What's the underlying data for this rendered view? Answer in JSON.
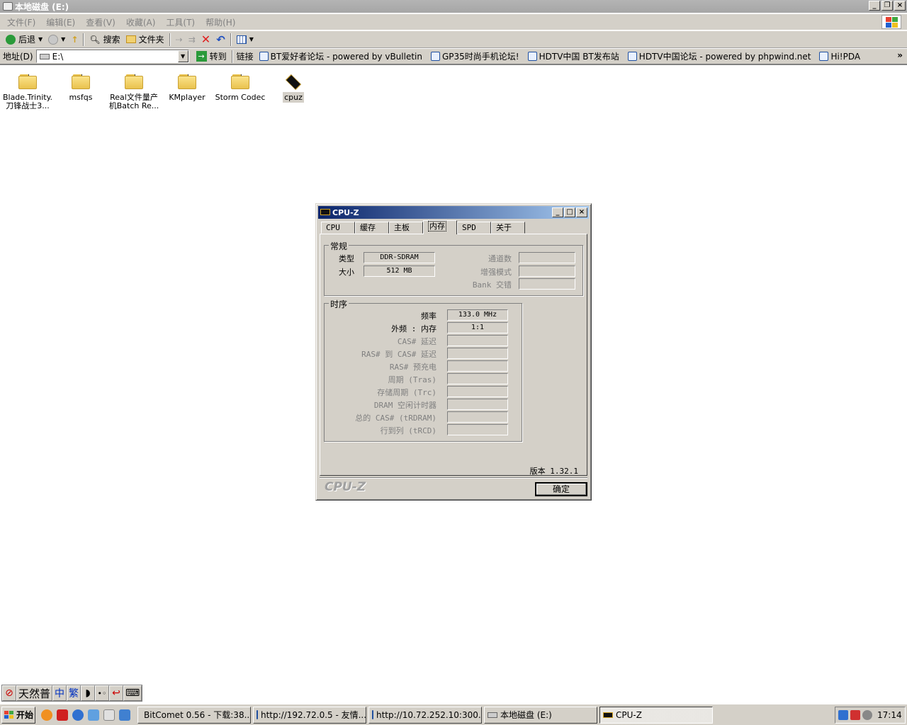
{
  "window": {
    "title": "本地磁盘 (E:)"
  },
  "menubar": [
    "文件(F)",
    "编辑(E)",
    "查看(V)",
    "收藏(A)",
    "工具(T)",
    "帮助(H)"
  ],
  "toolbar": {
    "back": "后退",
    "search": "搜索",
    "folders": "文件夹"
  },
  "address": {
    "label": "地址(D)",
    "value": "E:\\",
    "go": "转到",
    "links_label": "链接"
  },
  "links": [
    "BT爱好者论坛 - powered by vBulletin",
    "GP35时尚手机论坛!",
    "HDTV中国 BT发布站",
    "HDTV中国论坛 - powered by phpwind.net",
    "Hi!PDA"
  ],
  "files": [
    {
      "name": "Blade.Trinity.刀锋战士3...",
      "icon": "folder-icon"
    },
    {
      "name": "msfqs",
      "icon": "folder-icon"
    },
    {
      "name": "Real文件量产机Batch Re...",
      "icon": "folder-icon"
    },
    {
      "name": "KMplayer",
      "icon": "folder-icon"
    },
    {
      "name": "Storm Codec",
      "icon": "folder-icon"
    },
    {
      "name": "cpuz",
      "icon": "cpu-chip-icon"
    }
  ],
  "cpuz": {
    "title": "CPU-Z",
    "tabs": [
      "CPU",
      "缓存",
      "主板",
      "内存",
      "SPD",
      "关于"
    ],
    "active_tab": "内存",
    "general": {
      "label": "常规",
      "type_label": "类型",
      "type": "DDR-SDRAM",
      "size_label": "大小",
      "size": "512 MB",
      "channels_label": "通道数",
      "channels": "",
      "enhanced_label": "增强模式",
      "enhanced": "",
      "bank_label": "Bank 交错",
      "bank": ""
    },
    "timing": {
      "label": "时序",
      "rows": [
        {
          "label": "频率",
          "value": "133.0 MHz",
          "enabled": true
        },
        {
          "label": "外频 : 内存",
          "value": "1:1",
          "enabled": true
        },
        {
          "label": "CAS# 延迟",
          "value": "",
          "enabled": false
        },
        {
          "label": "RAS# 到 CAS# 延迟",
          "value": "",
          "enabled": false
        },
        {
          "label": "RAS# 预充电",
          "value": "",
          "enabled": false
        },
        {
          "label": "周期 (Tras)",
          "value": "",
          "enabled": false
        },
        {
          "label": "存储周期 (Trc)",
          "value": "",
          "enabled": false
        },
        {
          "label": "DRAM 空闲计时器",
          "value": "",
          "enabled": false
        },
        {
          "label": "总的 CAS# (tRDRAM)",
          "value": "",
          "enabled": false
        },
        {
          "label": "行到列 (tRCD)",
          "value": "",
          "enabled": false
        }
      ]
    },
    "version": "版本 1.32.1",
    "brand": "CPU-Z",
    "ok": "确定"
  },
  "ime": [
    "天然普",
    "中",
    "繁"
  ],
  "taskbar": {
    "start": "开始",
    "tasks": [
      {
        "label": "BitComet 0.56 - 下载:38...",
        "active": false
      },
      {
        "label": "http://192.72.0.5 - 友情...",
        "active": false
      },
      {
        "label": "http://10.72.252.10:300...",
        "active": false
      },
      {
        "label": "本地磁盘 (E:)",
        "active": false
      },
      {
        "label": "CPU-Z",
        "active": true
      }
    ],
    "clock": "17:14"
  }
}
